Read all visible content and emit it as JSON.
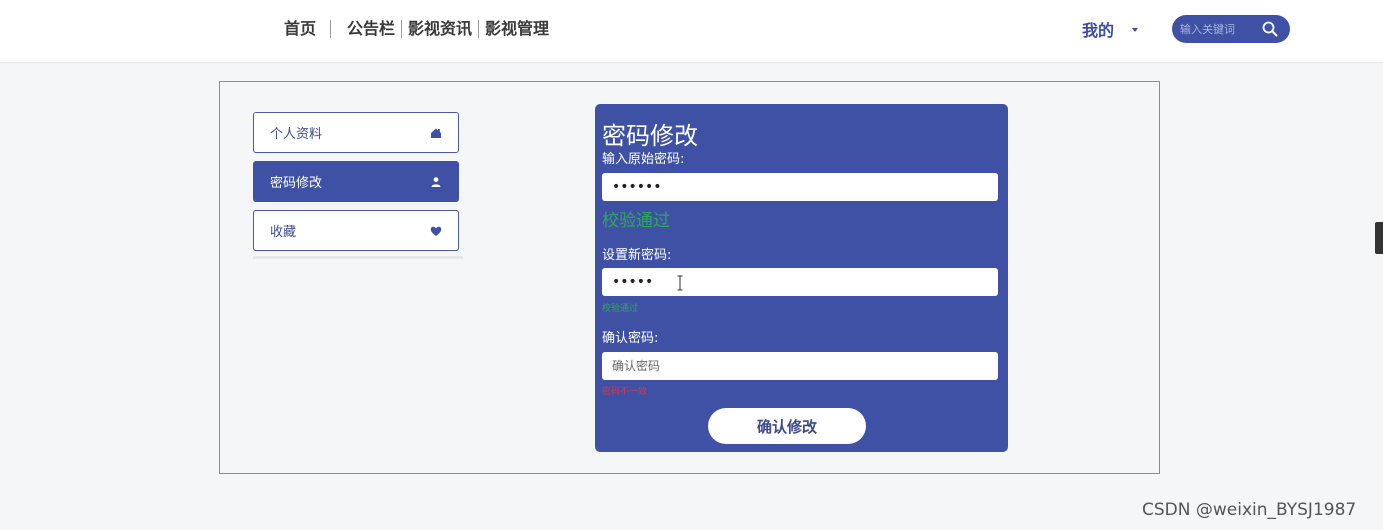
{
  "nav": {
    "home": "首页",
    "notice": "公告栏",
    "news": "影视资讯",
    "manage": "影视管理"
  },
  "user_menu": {
    "label": "我的"
  },
  "search": {
    "placeholder": "输入关键词"
  },
  "sidebar": {
    "items": [
      {
        "label": "个人资料",
        "icon": "home-icon"
      },
      {
        "label": "密码修改",
        "icon": "user-icon",
        "active": true
      },
      {
        "label": "收藏",
        "icon": "heart-icon"
      }
    ]
  },
  "form": {
    "title": "密码修改",
    "old_label": "输入原始密码:",
    "old_value": "••••••",
    "old_status": "校验通过",
    "new_label": "设置新密码:",
    "new_value": "•••••",
    "new_status": "校验通过",
    "confirm_label": "确认密码:",
    "confirm_placeholder": "确认密码",
    "confirm_status": "密码不一致",
    "submit_label": "确认修改"
  },
  "colors": {
    "accent": "#3f51a5",
    "success": "#2ea85a",
    "error": "#d9324c"
  },
  "watermark": "CSDN @weixin_BYSJ1987"
}
